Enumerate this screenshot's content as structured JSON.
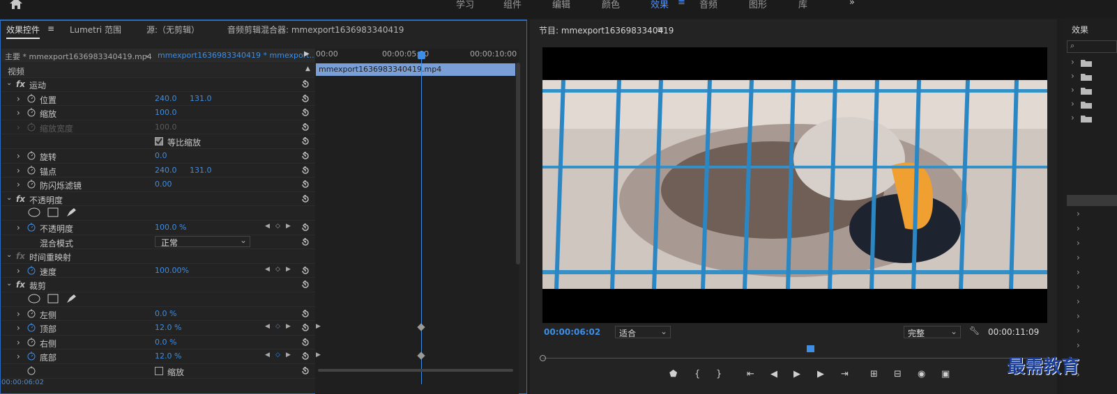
{
  "workspace_tabs": [
    "学习",
    "组件",
    "编辑",
    "颜色",
    "效果",
    "音频",
    "图形",
    "库"
  ],
  "workspace_more": "»",
  "effects_panel": {
    "tabs": [
      "效果控件",
      "Lumetri 范围",
      "源:（无剪辑）",
      "音频剪辑混合器: mmexport1636983340419"
    ],
    "master_label": "主要 * mmexport1636983340419.mp4",
    "sequence_label": "mmexport1636983340419 * mmexport...",
    "tc": [
      "00:00",
      "00:00:05:00",
      "00:00:10:00"
    ],
    "clip_bar": "mmexport1636983340419.mp4",
    "video_label": "视频",
    "rows": [
      {
        "name": "运动",
        "fx": true
      },
      {
        "name": "位置",
        "v1": "240.0",
        "v2": "131.0"
      },
      {
        "name": "缩放",
        "v1": "100.0"
      },
      {
        "name": "缩放宽度",
        "v1": "100.0",
        "disabled": true
      },
      {
        "name": "等比缩放",
        "checkbox": true
      },
      {
        "name": "旋转",
        "v1": "0.0"
      },
      {
        "name": "锚点",
        "v1": "240.0",
        "v2": "131.0"
      },
      {
        "name": "防闪烁滤镜",
        "v1": "0.00"
      },
      {
        "name": "不透明度",
        "fx": true
      },
      {
        "name": "",
        "shapes": true
      },
      {
        "name": "不透明度",
        "v1": "100.0 %"
      },
      {
        "name": "混合模式",
        "select": "正常"
      },
      {
        "name": "时间重映射",
        "fx": true
      },
      {
        "name": "速度",
        "v1": "100.00%"
      },
      {
        "name": "裁剪",
        "fx": true
      },
      {
        "name": "",
        "shapes": true
      },
      {
        "name": "左侧",
        "v1": "0.0 %"
      },
      {
        "name": "顶部",
        "v1": "12.0 %"
      },
      {
        "name": "右侧",
        "v1": "0.0 %"
      },
      {
        "name": "底部",
        "v1": "12.0 %"
      },
      {
        "name": "缩放",
        "checkbox": true
      }
    ],
    "bottom_tc": "00:00:06:02"
  },
  "program": {
    "title": "节目: mmexport1636983340419",
    "tc_left": "00:00:06:02",
    "fit": "适合",
    "quality": "完整",
    "tc_right": "00:00:11:09"
  },
  "right_panel": {
    "title": "效果"
  },
  "watermark": "最需教育",
  "colors": {
    "accent": "#3d8ee6",
    "panel": "#232323",
    "clip": "#7a9fd6"
  }
}
